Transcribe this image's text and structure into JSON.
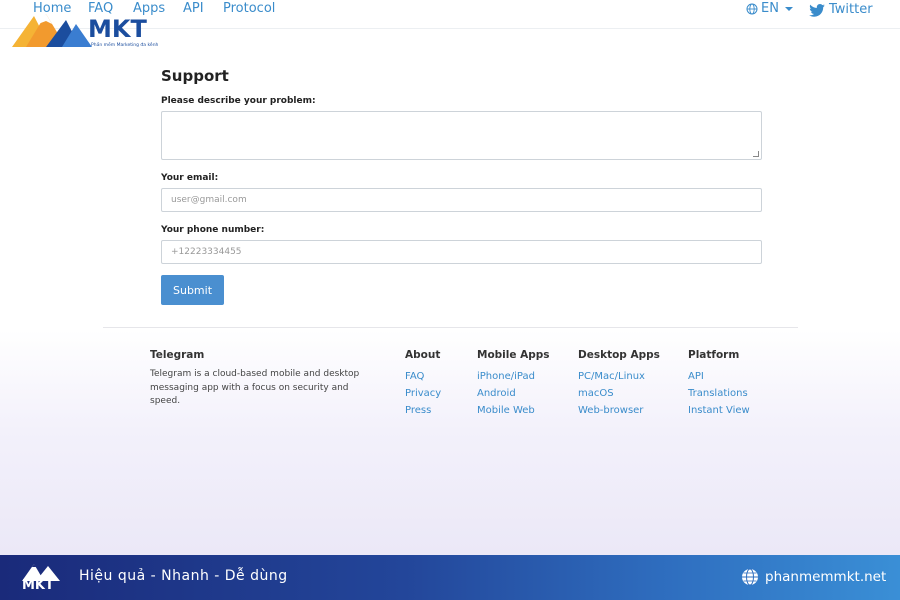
{
  "nav": {
    "items": [
      "Home",
      "FAQ",
      "Apps",
      "API",
      "Protocol"
    ],
    "language": "EN",
    "twitter": "Twitter"
  },
  "watermark": {
    "brand": "MKT",
    "tagline": "Phần mềm Marketing đa kênh"
  },
  "form": {
    "title": "Support",
    "problem_label": "Please describe your problem:",
    "problem_value": "",
    "email_label": "Your email:",
    "email_placeholder": "user@gmail.com",
    "phone_label": "Your phone number:",
    "phone_placeholder": "+12223334455",
    "submit_label": "Submit"
  },
  "footer": {
    "about_title": "Telegram",
    "about_text": "Telegram is a cloud-based mobile and desktop messaging app with a focus on security and speed.",
    "columns": [
      {
        "title": "About",
        "links": [
          "FAQ",
          "Privacy",
          "Press"
        ]
      },
      {
        "title": "Mobile Apps",
        "links": [
          "iPhone/iPad",
          "Android",
          "Mobile Web"
        ]
      },
      {
        "title": "Desktop Apps",
        "links": [
          "PC/Mac/Linux",
          "macOS",
          "Web-browser"
        ]
      },
      {
        "title": "Platform",
        "links": [
          "API",
          "Translations",
          "Instant View"
        ]
      }
    ]
  },
  "banner": {
    "slogan": "Hiệu quả - Nhanh  - Dễ dùng",
    "website": "phanmemmkt.net",
    "logo_text": "MKT"
  },
  "colors": {
    "link": "#3a8ccb",
    "button": "#4a8fd0",
    "brand": "#1b4d9e"
  }
}
